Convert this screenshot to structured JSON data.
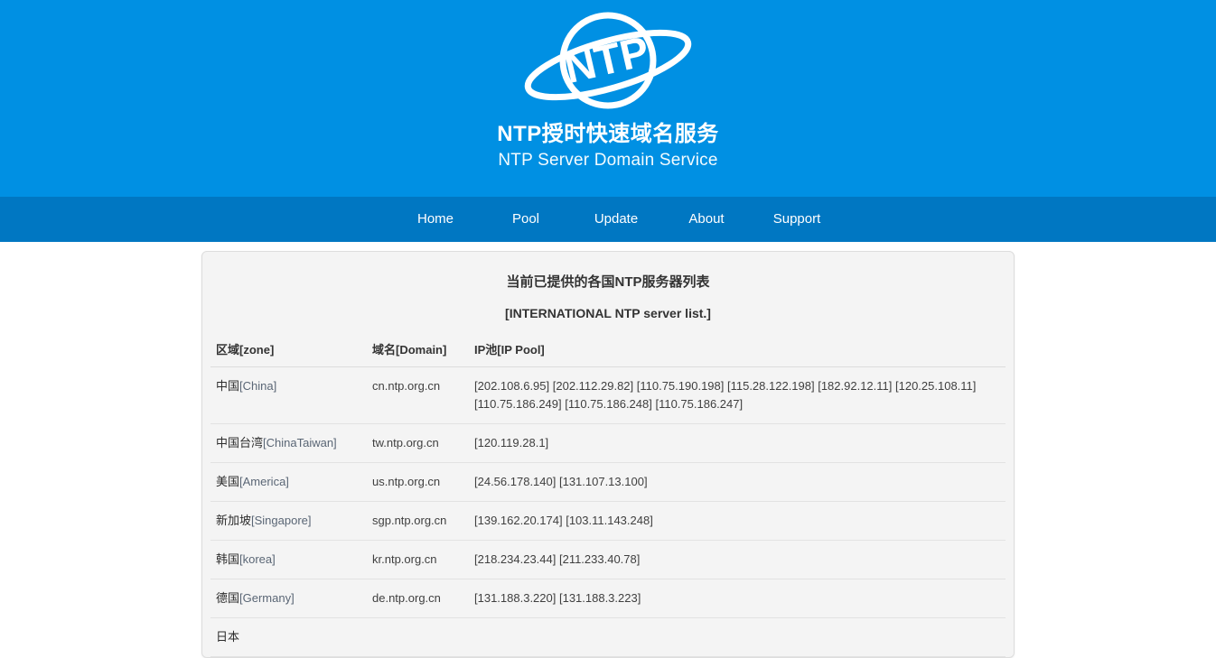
{
  "header": {
    "logo_icon": "ntp-planet-logo",
    "brand_cn": "NTP授时快速域名服务",
    "brand_en": "NTP Server Domain Service",
    "bg_color": "#0090e3"
  },
  "nav": {
    "bg_color": "#0077c2",
    "items": [
      {
        "label": "Home"
      },
      {
        "label": "Pool"
      },
      {
        "label": "Update"
      },
      {
        "label": "About"
      },
      {
        "label": "Support"
      }
    ]
  },
  "panel": {
    "title": "当前已提供的各国NTP服务器列表",
    "subtitle": "[INTERNATIONAL NTP server list.]",
    "table": {
      "columns": [
        {
          "label": "区域[zone]"
        },
        {
          "label": "域名[Domain]"
        },
        {
          "label": "IP池[IP Pool]"
        }
      ],
      "rows": [
        {
          "zone_name": "中国",
          "zone_alias": "[China]",
          "domain": "cn.ntp.org.cn",
          "ip_pool": "[202.108.6.95] [202.112.29.82] [110.75.190.198] [115.28.122.198] [182.92.12.11] [120.25.108.11] [110.75.186.249] [110.75.186.248] [110.75.186.247]"
        },
        {
          "zone_name": "中国台湾",
          "zone_alias": "[ChinaTaiwan]",
          "domain": "tw.ntp.org.cn",
          "ip_pool": "[120.119.28.1]"
        },
        {
          "zone_name": "美国",
          "zone_alias": "[America]",
          "domain": "us.ntp.org.cn",
          "ip_pool": "[24.56.178.140] [131.107.13.100]"
        },
        {
          "zone_name": "新加坡",
          "zone_alias": "[Singapore]",
          "domain": "sgp.ntp.org.cn",
          "ip_pool": "[139.162.20.174] [103.11.143.248]"
        },
        {
          "zone_name": "韩国",
          "zone_alias": "[korea]",
          "domain": "kr.ntp.org.cn",
          "ip_pool": "[218.234.23.44] [211.233.40.78]"
        },
        {
          "zone_name": "德国",
          "zone_alias": "[Germany]",
          "domain": "de.ntp.org.cn",
          "ip_pool": "[131.188.3.220] [131.188.3.223]"
        },
        {
          "zone_name": "日本",
          "zone_alias": "",
          "domain": "",
          "ip_pool": ""
        }
      ]
    }
  }
}
